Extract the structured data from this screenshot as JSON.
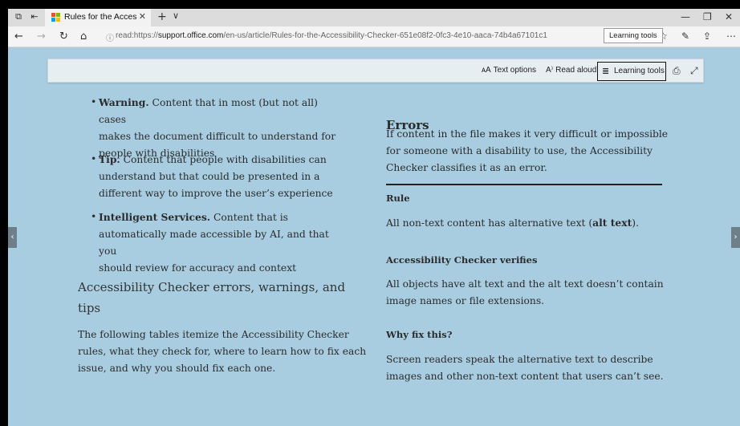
{
  "browser": {
    "tab_title": "Rules for the Accessibili",
    "url_prefix": "read:https://",
    "url_domain": "support.office.com",
    "url_path": "/en-us/article/Rules-for-the-Accessibility-Checker-651e08f2-0fc3-4e10-aaca-74b4a67101c1",
    "tooltip": "Learning tools"
  },
  "reader_toolbar": {
    "text_options": "Text options",
    "read_aloud": "Read aloud",
    "learning_tools": "Learning tools"
  },
  "left": {
    "bullets": [
      {
        "title": "Warning.",
        "lines": [
          " Content that in most (but not all) cases",
          "makes the document difficult to understand for",
          "people with disabilities"
        ]
      },
      {
        "title": "Tip.",
        "lines": [
          " Content that people with disabilities can",
          "understand but that could be presented in a",
          "different way to improve the user’s experience"
        ]
      },
      {
        "title": "Intelligent Services.",
        "lines": [
          " Content that is",
          "automatically made accessible by AI, and that you",
          "should review for accuracy and context"
        ]
      }
    ],
    "heading_line1": "Accessibility Checker errors, warnings, and",
    "heading_line2": "tips",
    "para": [
      "The following tables itemize the Accessibility Checker",
      "rules, what they check for, where to learn how to fix each",
      "issue, and why you should fix each one."
    ]
  },
  "right": {
    "errors_heading": "Errors",
    "errors_para": [
      "If content in the file makes it very difficult or impossible",
      "for someone with a disability to use, the Accessibility",
      "Checker classifies it as an error."
    ],
    "rule_label": "Rule",
    "rule_text_pre": "All non-text content has alternative text (",
    "rule_text_bold": "alt text",
    "rule_text_post": ").",
    "verifies_label": "Accessibility Checker verifies",
    "verifies_text": [
      "All objects have alt text and the alt text doesn’t contain",
      "image names or file extensions."
    ],
    "why_label": "Why fix this?",
    "why_text": [
      "Screen readers speak the alternative text to describe",
      "images and other non-text content that users can’t see."
    ]
  },
  "colors": {
    "page_bg": "#a8cde0",
    "toolbar_bg": "#e7eef2",
    "logo": [
      "#f25022",
      "#7fba00",
      "#00a4ef",
      "#ffb900"
    ]
  },
  "icons": [
    "tab-actions-icon",
    "set-aside-icon",
    "close-icon",
    "new-tab-icon",
    "chevron-down-icon",
    "minimize-icon",
    "restore-icon",
    "back-icon",
    "forward-icon",
    "refresh-icon",
    "home-icon",
    "info-icon",
    "favorites-icon",
    "reading-list-icon",
    "pen-icon",
    "share-icon",
    "more-icon",
    "text-options-icon",
    "read-aloud-icon",
    "learning-tools-icon",
    "print-icon",
    "fullscreen-icon",
    "chevron-left-icon",
    "chevron-right-icon"
  ]
}
